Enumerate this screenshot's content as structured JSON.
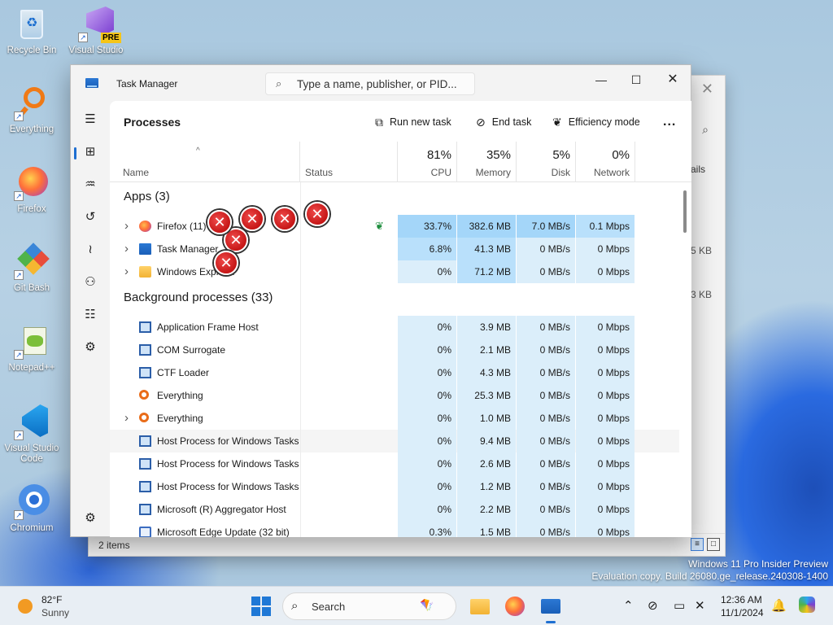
{
  "desktop": {
    "icons": [
      {
        "label": "Recycle Bin"
      },
      {
        "label": "Visual Studio 2022 P..."
      },
      {
        "label": "Everything"
      },
      {
        "label": "Firefox"
      },
      {
        "label": "Git Bash"
      },
      {
        "label": "Notepad++"
      },
      {
        "label": "Visual Studio Code"
      },
      {
        "label": "Chromium"
      }
    ],
    "vs_badge": "PRE",
    "watermark_line1": "Windows 11 Pro Insider Preview",
    "watermark_line2": "Evaluation copy. Build 26080.ge_release.240308-1400"
  },
  "background_window": {
    "col_fragment": "ails",
    "size1": "5 KB",
    "size2": "3 KB",
    "items_count": "2 items"
  },
  "task_manager": {
    "title": "Task Manager",
    "search_placeholder": "Type a name, publisher, or PID...",
    "page_title": "Processes",
    "commands": {
      "run_new_task": "Run new task",
      "end_task": "End task",
      "efficiency_mode": "Efficiency mode",
      "more": "..."
    },
    "columns": {
      "name": "Name",
      "status": "Status",
      "cpu": {
        "pct": "81%",
        "label": "CPU"
      },
      "memory": {
        "pct": "35%",
        "label": "Memory"
      },
      "disk": {
        "pct": "5%",
        "label": "Disk"
      },
      "network": {
        "pct": "0%",
        "label": "Network"
      }
    },
    "groups": {
      "apps": "Apps (3)",
      "background": "Background processes (33)"
    },
    "apps": [
      {
        "name": "Firefox (11)",
        "cpu": "33.7%",
        "memory": "382.6 MB",
        "disk": "7.0 MB/s",
        "network": "0.1 Mbps",
        "expandable": true,
        "icon": "firefox-icon",
        "efficiency": true
      },
      {
        "name": "Task Manager",
        "cpu": "6.8%",
        "memory": "41.3 MB",
        "disk": "0 MB/s",
        "network": "0 Mbps",
        "expandable": true,
        "icon": "task-manager-icon"
      },
      {
        "name": "Windows Explorer",
        "cpu": "0%",
        "memory": "71.2 MB",
        "disk": "0 MB/s",
        "network": "0 Mbps",
        "expandable": true,
        "icon": "folder-icon"
      }
    ],
    "background": [
      {
        "name": "Application Frame Host",
        "cpu": "0%",
        "memory": "3.9 MB",
        "disk": "0 MB/s",
        "network": "0 Mbps",
        "icon": "window-icon"
      },
      {
        "name": "COM Surrogate",
        "cpu": "0%",
        "memory": "2.1 MB",
        "disk": "0 MB/s",
        "network": "0 Mbps",
        "icon": "window-icon"
      },
      {
        "name": "CTF Loader",
        "cpu": "0%",
        "memory": "4.3 MB",
        "disk": "0 MB/s",
        "network": "0 Mbps",
        "icon": "window-icon"
      },
      {
        "name": "Everything",
        "cpu": "0%",
        "memory": "25.3 MB",
        "disk": "0 MB/s",
        "network": "0 Mbps",
        "icon": "everything-icon"
      },
      {
        "name": "Everything",
        "cpu": "0%",
        "memory": "1.0 MB",
        "disk": "0 MB/s",
        "network": "0 Mbps",
        "icon": "everything-icon",
        "expandable": true
      },
      {
        "name": "Host Process for Windows Tasks",
        "cpu": "0%",
        "memory": "9.4 MB",
        "disk": "0 MB/s",
        "network": "0 Mbps",
        "icon": "window-icon",
        "hover": true
      },
      {
        "name": "Host Process for Windows Tasks",
        "cpu": "0%",
        "memory": "2.6 MB",
        "disk": "0 MB/s",
        "network": "0 Mbps",
        "icon": "window-icon"
      },
      {
        "name": "Host Process for Windows Tasks",
        "cpu": "0%",
        "memory": "1.2 MB",
        "disk": "0 MB/s",
        "network": "0 Mbps",
        "icon": "window-icon"
      },
      {
        "name": "Microsoft (R) Aggregator Host",
        "cpu": "0%",
        "memory": "2.2 MB",
        "disk": "0 MB/s",
        "network": "0 Mbps",
        "icon": "window-icon"
      },
      {
        "name": "Microsoft Edge Update (32 bit)",
        "cpu": "0.3%",
        "memory": "1.5 MB",
        "disk": "0 MB/s",
        "network": "0 Mbps",
        "icon": "edge-update-icon"
      }
    ]
  },
  "taskbar": {
    "weather_temp": "82°F",
    "weather_cond": "Sunny",
    "search_label": "Search",
    "time": "12:36 AM",
    "date": "11/1/2024"
  },
  "colors": {
    "accent": "#1f6fd1",
    "heat_light": "#dbeefa",
    "heat_mid": "#b9e0fb",
    "heat_high": "#a4d6f9"
  }
}
